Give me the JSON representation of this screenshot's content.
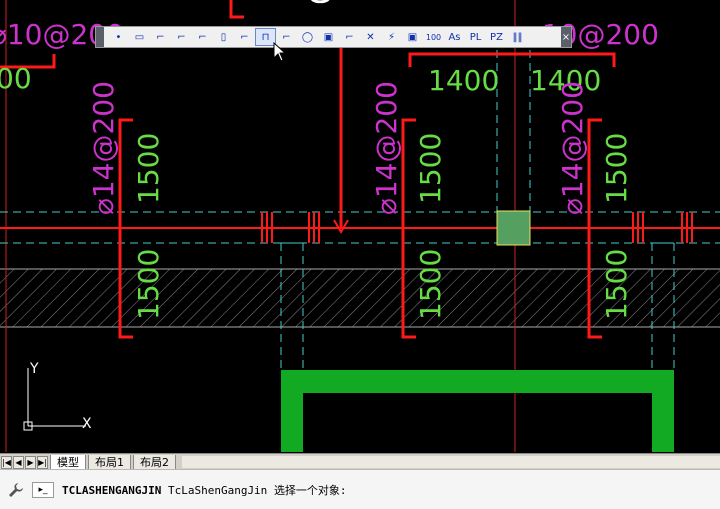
{
  "drawing": {
    "labels": [
      "⌀10@200",
      "1400",
      "1400",
      "⌀14@200",
      "⌀14@200",
      "⌀14@200",
      "1500",
      "1500",
      "1500",
      "1500",
      "1500",
      "1500",
      "⌀10@200",
      "00",
      "00"
    ]
  },
  "toolbar": {
    "tool_glyphs": [
      "•",
      "▭",
      "⌐",
      "⌐",
      "⌐",
      "▯",
      "⌐",
      "⊓",
      "⌐",
      "◯",
      "▣",
      "⌐",
      "✕",
      "⚡",
      "▣",
      "100",
      "As",
      "PL",
      "PZ",
      "‖‖"
    ],
    "active_index": 7,
    "close_glyph": "×"
  },
  "layout_tabs": {
    "nav": [
      "|◀",
      "◀",
      "▶",
      "▶|"
    ],
    "tabs": [
      "模型",
      "布局1",
      "布局2"
    ],
    "active": "模型"
  },
  "ucs": {
    "x_label": "X",
    "y_label": "Y"
  },
  "command_line": {
    "command_upper": "TCLASHENGANGJIN",
    "command_camel": "TcLaShenGangJin",
    "prompt": "选择一个对象:"
  },
  "colors": {
    "rebar_red": "#ff1a1a",
    "text_green": "#66dd44",
    "text_magenta": "#cc33cc",
    "axis_cyan": "#44cccc",
    "fill_green": "#11aa22"
  }
}
